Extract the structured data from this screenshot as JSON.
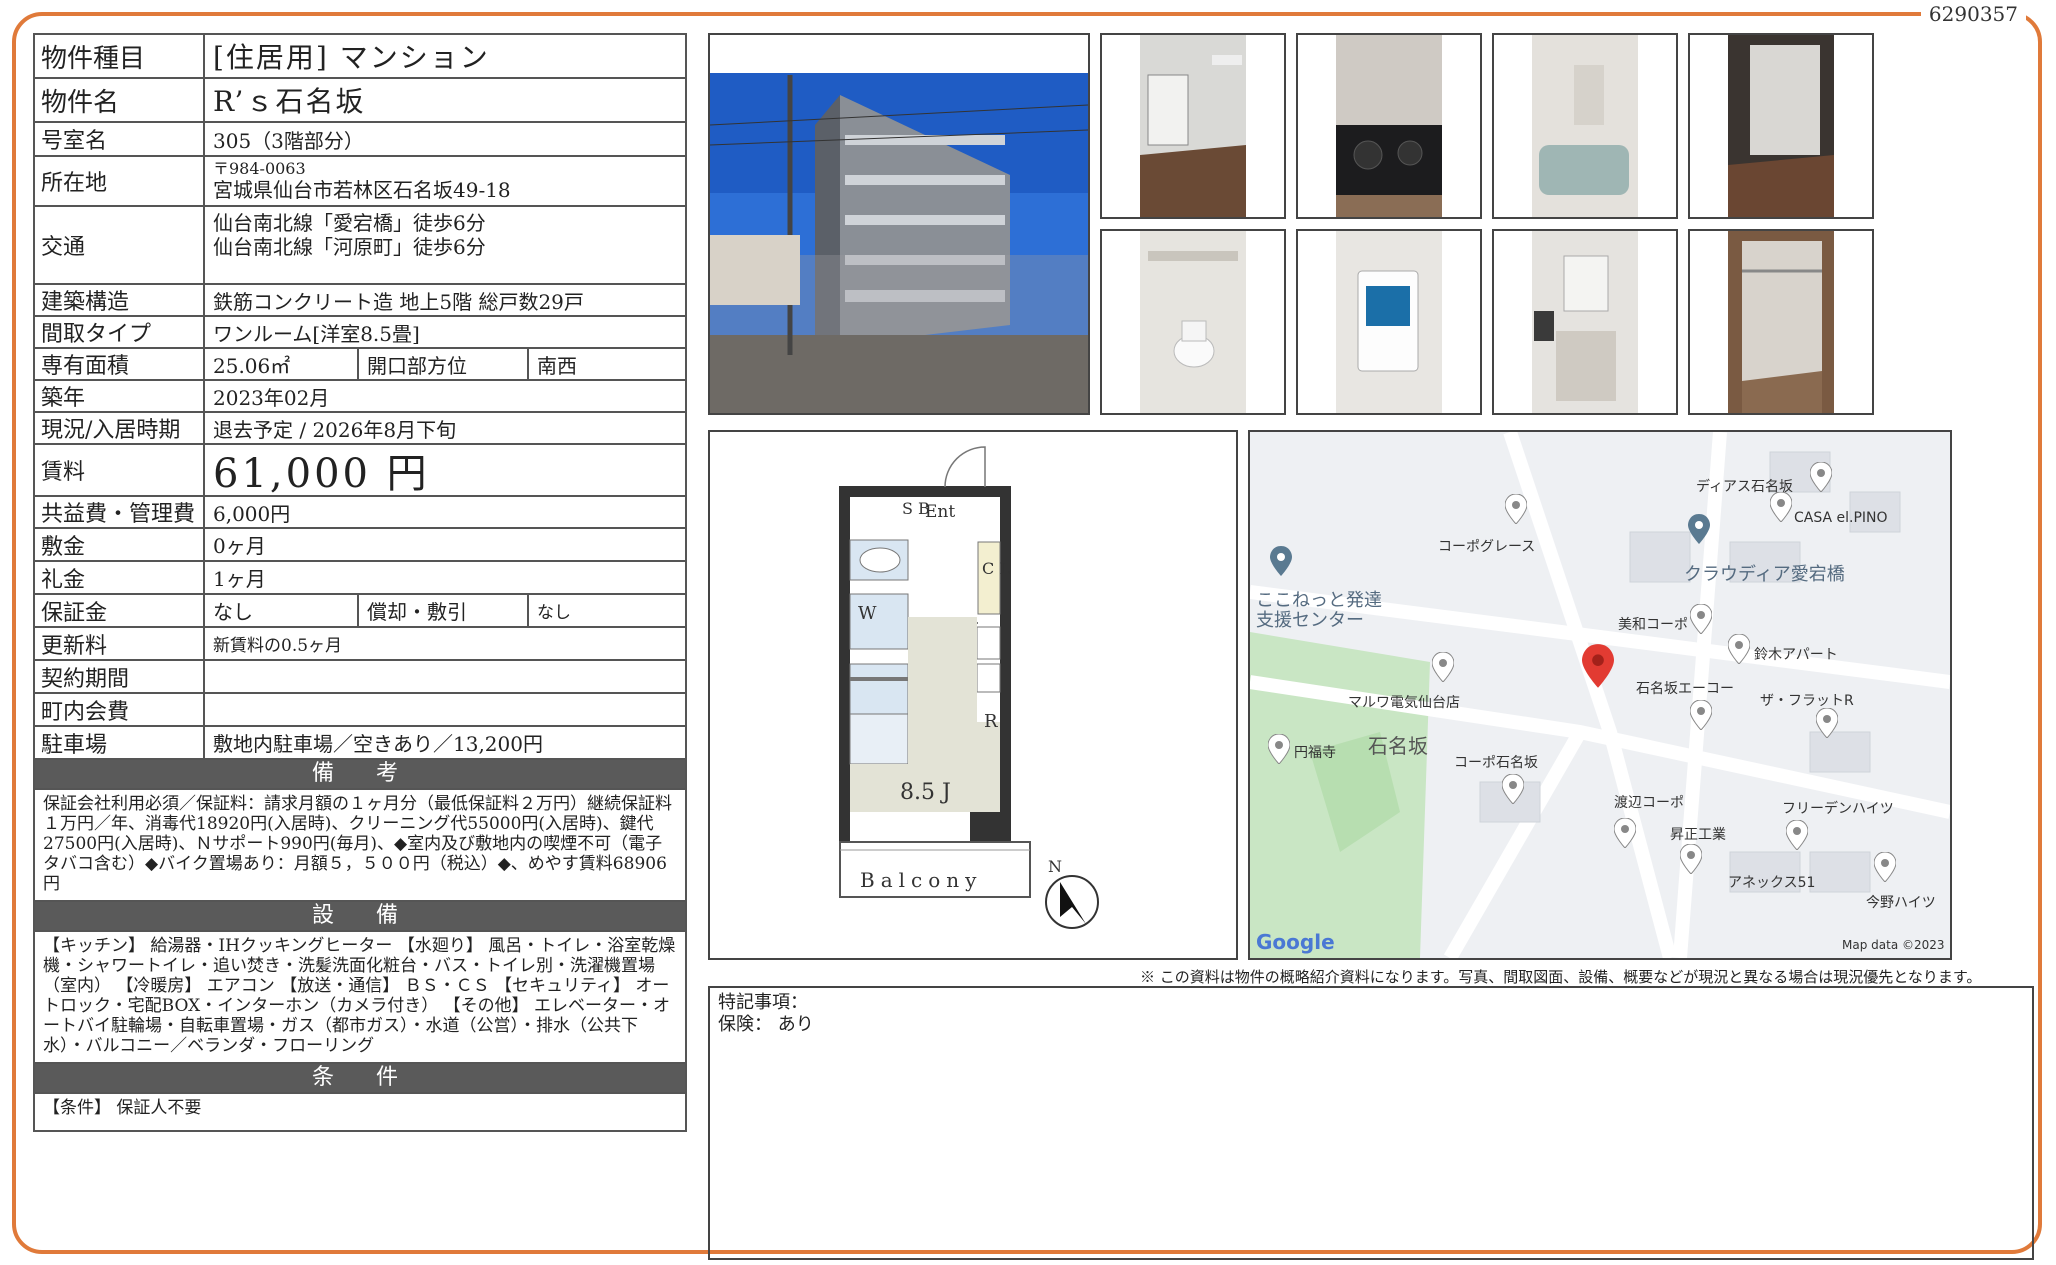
{
  "document_id": "6290357",
  "property": {
    "type_label": "物件種目",
    "type_value": "[住居用]  マンション",
    "name_label": "物件名",
    "name_value": "R’ｓ石名坂",
    "room_label": "号室名",
    "room_value": "305（3階部分）",
    "address_label": "所在地",
    "postal": "〒984-0063",
    "address": "宮城県仙台市若林区石名坂49-18",
    "access_label": "交通",
    "access1": "仙台南北線「愛宕橋」徒歩6分",
    "access2": "仙台南北線「河原町」徒歩6分",
    "structure_label": "建築構造",
    "structure_value": "鉄筋コンクリート造 地上5階 総戸数29戸",
    "layout_label": "間取タイプ",
    "layout_value": "ワンルーム[洋室8.5畳]",
    "area_label": "専有面積",
    "area_value": "25.06㎡",
    "opening_label": "開口部方位",
    "opening_value": "南西",
    "built_label": "築年",
    "built_value": "2023年02月",
    "status_label": "現況/入居時期",
    "status_value": "退去予定 / 2026年8月下旬",
    "rent_label": "賃料",
    "rent_value": "61,000 円",
    "fee_label": "共益費・管理費",
    "fee_value": "6,000円",
    "deposit_label": "敷金",
    "deposit_value": "0ヶ月",
    "keymoney_label": "礼金",
    "keymoney_value": "1ヶ月",
    "guarantee_label": "保証金",
    "guarantee_value": "なし",
    "amort_label": "償却・敷引",
    "amort_value": "なし",
    "renewal_label": "更新料",
    "renewal_value": "新賃料の0.5ヶ月",
    "contract_label": "契約期間",
    "contract_value": "",
    "community_label": "町内会費",
    "community_value": "",
    "parking_label": "駐車場",
    "parking_value": "敷地内駐車場／空きあり／13,200円"
  },
  "remarks": {
    "title": "備　考",
    "text": "保証会社利用必須／保証料：請求月額の１ヶ月分（最低保証料２万円）継続保証料１万円／年、消毒代18920円(入居時)、クリーニング代55000円(入居時)、鍵代27500円(入居時)、Ｎサポート990円(毎月)、◆室内及び敷地内の喫煙不可（電子タバコ含む）◆バイク置場あり：月額５，５００円（税込）◆、めやす賃料68906円"
  },
  "equipment": {
    "title": "設　備",
    "text": "【キッチン】 給湯器・IHクッキングヒーター 【水廻り】 風呂・トイレ・浴室乾燥機・シャワートイレ・追い焚き・洗髪洗面化粧台・バス・トイレ別・洗濯機置場（室内） 【冷暖房】 エアコン 【放送・通信】 ＢＳ・ＣＳ 【セキュリティ】 オートロック・宅配BOX・インターホン（カメラ付き） 【その他】 エレベーター・オートバイ駐輪場・自転車置場・ガス（都市ガス）・水道（公営）・排水（公共下水）・バルコニー／ベランダ・フローリング"
  },
  "conditions": {
    "title": "条　件",
    "text": "【条件】 保証人不要"
  },
  "floorplan": {
    "sb": "S B",
    "ent": "Ent",
    "cl": "C L",
    "w": "W",
    "r": "R",
    "room": "8.5 J",
    "balcony": "Balcony",
    "north": "N"
  },
  "map": {
    "labels": [
      "ディアス石名坂",
      "CASA el.PINO",
      "コーポグレース",
      "クラウディア愛宕橋",
      "ここねっと発達",
      "支援センター",
      "美和コーポ",
      "鈴木アパート",
      "マルワ電気仙台店",
      "石名坂エーコー",
      "ザ・フラットR",
      "円福寺",
      "石名坂",
      "コーポ石名坂",
      "渡辺コーポ",
      "フリーデンハイツ",
      "昇正工業",
      "アネックス51",
      "今野ハイツ"
    ],
    "google": "Google",
    "mapdata": "Map data ©2023"
  },
  "notice": "※ この資料は物件の概略紹介資料になります。写真、間取図面、設備、概要などが現況と異なる場合は現況優先となります。",
  "special": {
    "title": "特記事項：",
    "insurance": "保険： あり"
  }
}
